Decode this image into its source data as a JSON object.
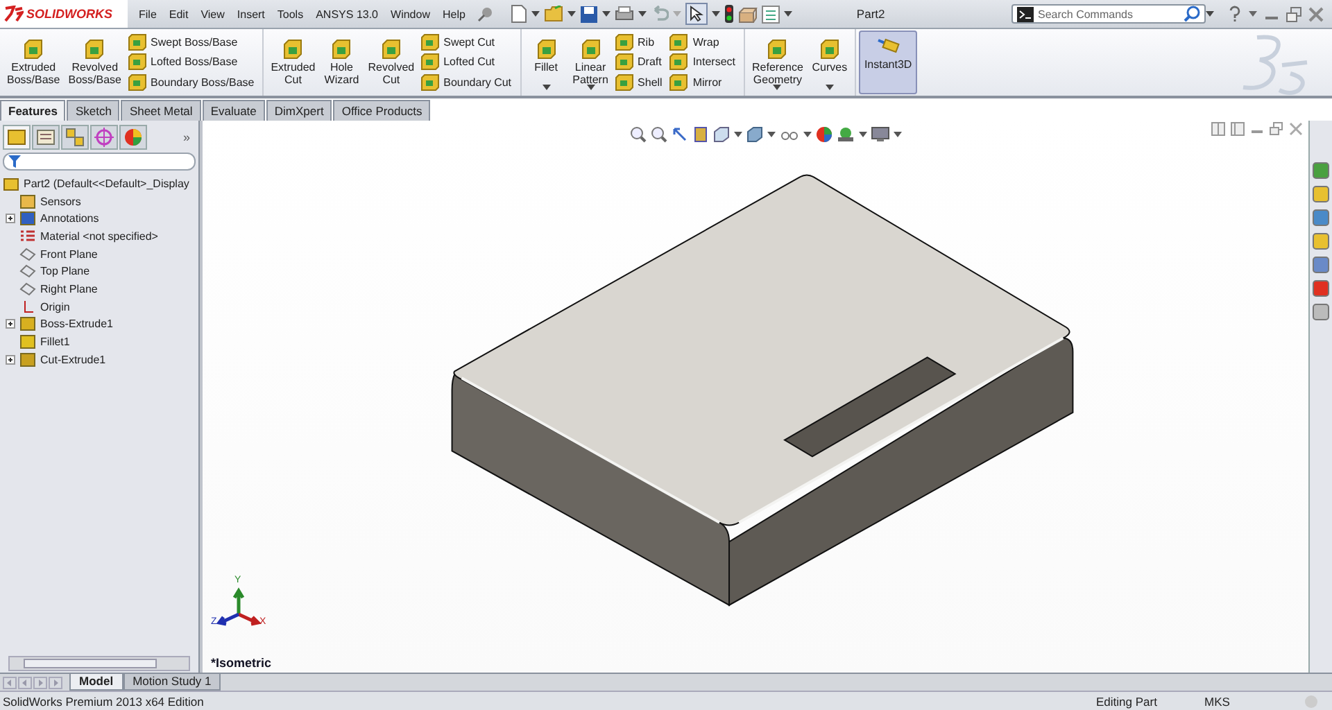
{
  "app": {
    "logo": "SOLIDWORKS",
    "title": "Part2"
  },
  "menu": [
    "File",
    "Edit",
    "View",
    "Insert",
    "Tools",
    "ANSYS 13.0",
    "Window",
    "Help"
  ],
  "search": {
    "placeholder": "Search Commands"
  },
  "ribbon": {
    "groups": [
      {
        "items": [
          {
            "kind": "large",
            "label": "Extruded\nBoss/Base",
            "dropdown": false
          },
          {
            "kind": "large",
            "label": "Revolved\nBoss/Base",
            "dropdown": false
          },
          {
            "kind": "column",
            "labels": [
              "Swept Boss/Base",
              "Lofted Boss/Base",
              "Boundary Boss/Base"
            ]
          }
        ]
      },
      {
        "items": [
          {
            "kind": "large",
            "label": "Extruded\nCut",
            "dropdown": false
          },
          {
            "kind": "large",
            "label": "Hole\nWizard",
            "dropdown": false
          },
          {
            "kind": "large",
            "label": "Revolved\nCut",
            "dropdown": false
          },
          {
            "kind": "column",
            "labels": [
              "Swept Cut",
              "Lofted Cut",
              "Boundary Cut"
            ]
          }
        ]
      },
      {
        "items": [
          {
            "kind": "large",
            "label": "Fillet",
            "dropdown": true
          },
          {
            "kind": "large",
            "label": "Linear\nPattern",
            "dropdown": true
          },
          {
            "kind": "column",
            "labels": [
              "Rib",
              "Draft",
              "Shell"
            ]
          },
          {
            "kind": "column",
            "labels": [
              "Wrap",
              "Intersect",
              "Mirror"
            ]
          }
        ]
      },
      {
        "items": [
          {
            "kind": "large",
            "label": "Reference\nGeometry",
            "dropdown": true
          },
          {
            "kind": "large",
            "label": "Curves",
            "dropdown": true
          }
        ]
      }
    ],
    "toggle": {
      "label": "Instant3D",
      "on": true
    }
  },
  "tabs": [
    {
      "label": "Features",
      "selected": true
    },
    {
      "label": "Sketch",
      "selected": false
    },
    {
      "label": "Sheet Metal",
      "selected": false
    },
    {
      "label": "Evaluate",
      "selected": false
    },
    {
      "label": "DimXpert",
      "selected": false
    },
    {
      "label": "Office Products",
      "selected": false
    }
  ],
  "panel_tabs": {
    "more": "»"
  },
  "tree": {
    "root": "Part2  (Default<<Default>_Display",
    "children": [
      {
        "label": "Sensors",
        "kind": "sensors",
        "has_children": false
      },
      {
        "label": "Annotations",
        "kind": "annotations",
        "has_children": true
      },
      {
        "label": "Material <not specified>",
        "kind": "material",
        "has_children": false
      },
      {
        "label": "Front Plane",
        "kind": "plane",
        "has_children": false
      },
      {
        "label": "Top Plane",
        "kind": "plane",
        "has_children": false
      },
      {
        "label": "Right Plane",
        "kind": "plane",
        "has_children": false
      },
      {
        "label": "Origin",
        "kind": "origin",
        "has_children": false
      },
      {
        "label": "Boss-Extrude1",
        "kind": "extrude",
        "has_children": true
      },
      {
        "label": "Fillet1",
        "kind": "fillet",
        "has_children": false
      },
      {
        "label": "Cut-Extrude1",
        "kind": "cut",
        "has_children": true
      }
    ]
  },
  "viewport": {
    "triad": {
      "x": "X",
      "y": "Y",
      "z": "Z"
    },
    "view_name": "*Isometric"
  },
  "bottom_tabs": [
    {
      "label": "Model",
      "selected": true
    },
    {
      "label": "Motion Study 1",
      "selected": false
    }
  ],
  "status_bar": {
    "edition": "SolidWorks Premium 2013 x64 Edition",
    "mode": "Editing Part",
    "units": "MKS"
  }
}
